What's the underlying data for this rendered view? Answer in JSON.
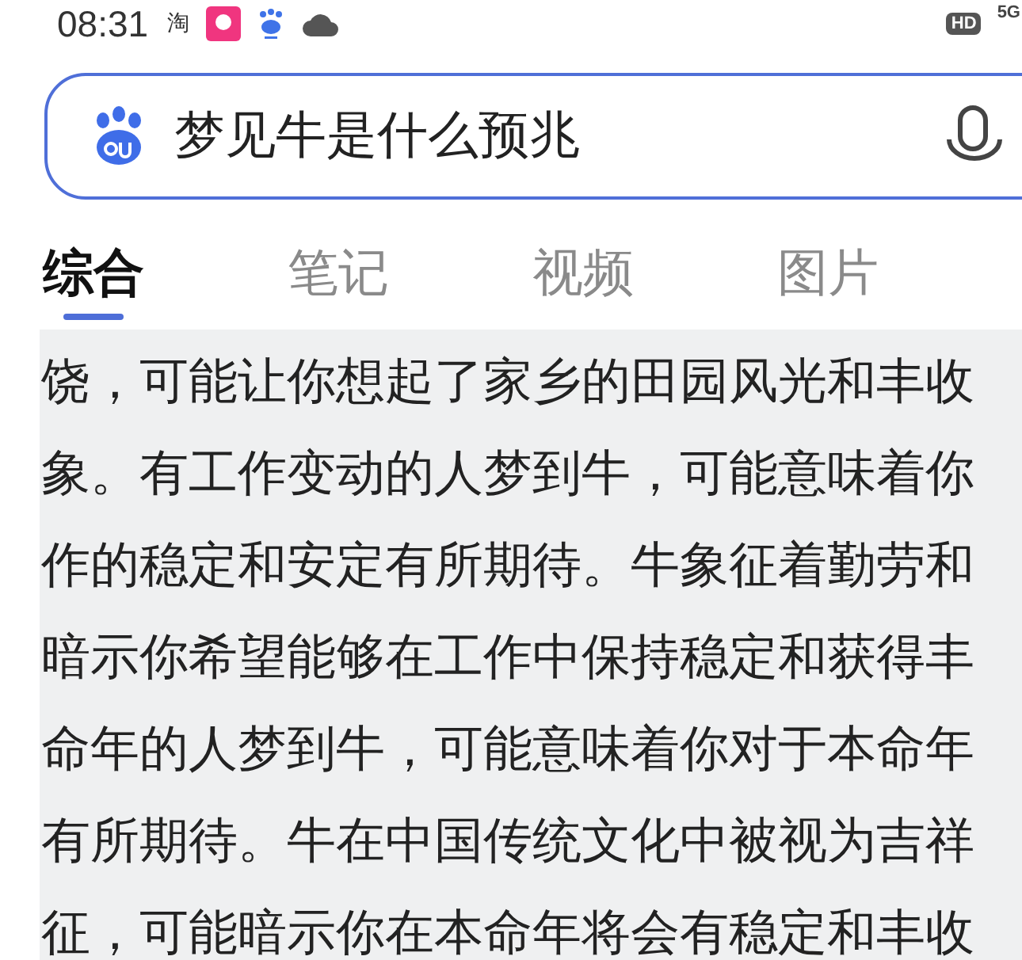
{
  "status_bar": {
    "time": "08:31",
    "app_glyph": "淘",
    "hd": "HD",
    "network": "5G"
  },
  "search": {
    "query": "梦见牛是什么预兆"
  },
  "tabs": [
    {
      "label": "综合",
      "selected": true
    },
    {
      "label": "笔记",
      "selected": false
    },
    {
      "label": "视频",
      "selected": false
    },
    {
      "label": "图片",
      "selected": false
    }
  ],
  "article_lines": [
    "饶，可能让你想起了家乡的田园风光和丰收",
    "象。有工作变动的人梦到牛，可能意味着你",
    "作的稳定和安定有所期待。牛象征着勤劳和",
    "暗示你希望能够在工作中保持稳定和获得丰",
    "命年的人梦到牛，可能意味着你对于本命年",
    "有所期待。牛在中国传统文化中被视为吉祥",
    "征，可能暗示你在本命年将会有稳定和丰收"
  ]
}
